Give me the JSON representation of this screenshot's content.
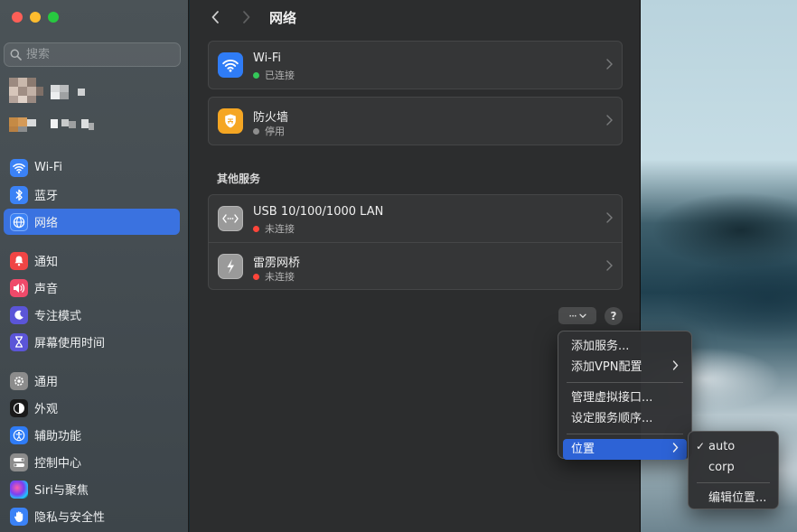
{
  "window": {
    "title": "网络"
  },
  "sidebar": {
    "search_placeholder": "搜索",
    "items": [
      {
        "label": "Wi-Fi",
        "icon": "wifi-icon",
        "color": "#3b82f6"
      },
      {
        "label": "蓝牙",
        "icon": "bluetooth-icon",
        "color": "#3b82f6"
      },
      {
        "label": "网络",
        "icon": "globe-icon",
        "color": "#3b82f6",
        "active": true
      },
      {
        "label": "通知",
        "icon": "bell-icon",
        "color": "#f04545"
      },
      {
        "label": "声音",
        "icon": "speaker-icon",
        "color": "#ef4a6a"
      },
      {
        "label": "专注模式",
        "icon": "moon-icon",
        "color": "#5b55d8"
      },
      {
        "label": "屏幕使用时间",
        "icon": "hourglass-icon",
        "color": "#5b55d8"
      },
      {
        "label": "通用",
        "icon": "gear-icon",
        "color": "#8c8c8c"
      },
      {
        "label": "外观",
        "icon": "appearance-icon",
        "color": "#1a1a1a"
      },
      {
        "label": "辅助功能",
        "icon": "accessibility-icon",
        "color": "#2f7cf6"
      },
      {
        "label": "控制中心",
        "icon": "toggles-icon",
        "color": "#8c8c8c"
      },
      {
        "label": "Siri与聚焦",
        "icon": "siri-icon",
        "color": "#222"
      },
      {
        "label": "隐私与安全性",
        "icon": "hand-icon",
        "color": "#3b82f6"
      }
    ]
  },
  "main": {
    "services": [
      {
        "title": "Wi-Fi",
        "status": "已连接",
        "status_color": "#34c759",
        "icon": "wifi-icon",
        "icon_color": "#2f7cf6"
      },
      {
        "title": "防火墙",
        "status": "停用",
        "status_color": "#8e8e8e",
        "icon": "firewall-shield-icon",
        "icon_color": "#f5a623"
      }
    ],
    "other_title": "其他服务",
    "other_services": [
      {
        "title": "USB 10/100/1000 LAN",
        "status": "未连接",
        "status_color": "#ff453a",
        "icon": "ethernet-icon",
        "icon_color": "#9a9a9a"
      },
      {
        "title": "雷雳网桥",
        "status": "未连接",
        "status_color": "#ff453a",
        "icon": "thunderbolt-icon",
        "icon_color": "#9a9a9a"
      }
    ],
    "more_button": "···",
    "help_button": "?"
  },
  "context_menu": {
    "items": [
      "添加服务...",
      "添加VPN配置",
      "管理虚拟接口...",
      "设定服务顺序...",
      "位置"
    ]
  },
  "location_menu": {
    "items": [
      "auto",
      "corp",
      "编辑位置..."
    ],
    "checked": "auto"
  }
}
